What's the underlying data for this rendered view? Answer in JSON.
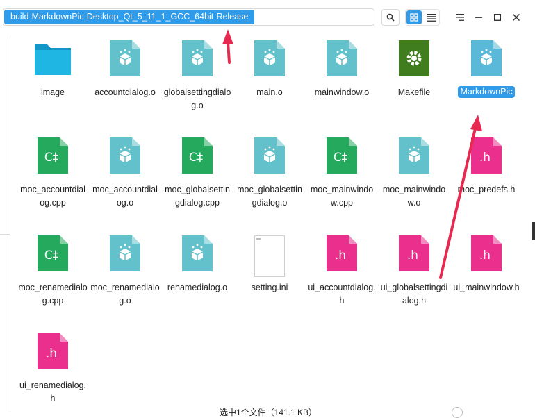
{
  "path": "build-MarkdownPic-Desktop_Qt_5_11_1_GCC_64bit-Release",
  "colors": {
    "accent": "#2f9be9",
    "arrow": "#e8294f",
    "object_file": "#63c1cb",
    "cpp_file": "#25a95c",
    "header_file": "#ea2f8d",
    "folder": "#1fb6e4",
    "makefile": "#3f7d1f"
  },
  "files": [
    {
      "name": "image",
      "type": "folder"
    },
    {
      "name": "accountdialog.o",
      "type": "object"
    },
    {
      "name": "globalsettingdialog.o",
      "type": "object"
    },
    {
      "name": "main.o",
      "type": "object"
    },
    {
      "name": "mainwindow.o",
      "type": "object"
    },
    {
      "name": "Makefile",
      "type": "makefile"
    },
    {
      "name": "MarkdownPic",
      "type": "executable",
      "selected": true
    },
    {
      "name": "moc_accountdialog.cpp",
      "type": "cpp"
    },
    {
      "name": "moc_accountdialog.o",
      "type": "object"
    },
    {
      "name": "moc_globalsettingdialog.cpp",
      "type": "cpp"
    },
    {
      "name": "moc_globalsettingdialog.o",
      "type": "object"
    },
    {
      "name": "moc_mainwindow.cpp",
      "type": "cpp"
    },
    {
      "name": "moc_mainwindow.o",
      "type": "object"
    },
    {
      "name": "moc_predefs.h",
      "type": "header"
    },
    {
      "name": "moc_renamedialog.cpp",
      "type": "cpp"
    },
    {
      "name": "moc_renamedialog.o",
      "type": "object"
    },
    {
      "name": "renamedialog.o",
      "type": "object"
    },
    {
      "name": "setting.ini",
      "type": "ini"
    },
    {
      "name": "ui_accountdialog.h",
      "type": "header"
    },
    {
      "name": "ui_globalsettingdialog.h",
      "type": "header"
    },
    {
      "name": "ui_mainwindow.h",
      "type": "header"
    },
    {
      "name": "ui_renamedialog.h",
      "type": "header"
    }
  ],
  "icon_glyphs": {
    "cpp": "C‡",
    "header": ".h"
  },
  "status": "选中1个文件（141.1 KB）"
}
